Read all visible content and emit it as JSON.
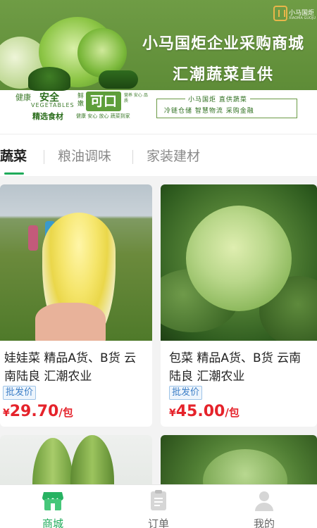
{
  "banner": {
    "logo_text": "小马国炬",
    "logo_sub": "XIAOMA GUOJU",
    "title_line1": "小马国炬企业采购商城",
    "title_line2": "汇潮蔬菜直供",
    "left_health": "健康",
    "left_safe": "安全",
    "left_vegetables": "VEGETABLES",
    "left_select": "精选食材",
    "left_fresh": "鲜嫩",
    "left_kekou": "可口",
    "left_side": "营养 安心 品质",
    "left_small": "健康 安心 放心   蔬菜到家",
    "right_top": "小马国炬 直供蔬菜",
    "right_bottom": "冷链仓储  智慧物流  采购金融"
  },
  "tabs": [
    {
      "label": "蔬菜",
      "active": true
    },
    {
      "label": "粮油调味",
      "active": false
    },
    {
      "label": "家装建材",
      "active": false
    }
  ],
  "products": [
    {
      "title": "娃娃菜 精品A货、B货 云南陆良 汇潮农业",
      "tag": "批发价",
      "currency": "¥",
      "price": "29.70",
      "unit": "/包"
    },
    {
      "title": "包菜 精品A货、B货 云南陆良 汇潮农业",
      "tag": "批发价",
      "currency": "¥",
      "price": "45.00",
      "unit": "/包"
    }
  ],
  "nav": [
    {
      "label": "商城",
      "icon": "store-icon",
      "active": true
    },
    {
      "label": "订单",
      "icon": "order-icon",
      "active": false
    },
    {
      "label": "我的",
      "icon": "profile-icon",
      "active": false
    }
  ],
  "colors": {
    "accent": "#1fab5a",
    "price": "#e5232b",
    "tag_text": "#3d7fc7",
    "banner_green": "#5e8c37"
  }
}
